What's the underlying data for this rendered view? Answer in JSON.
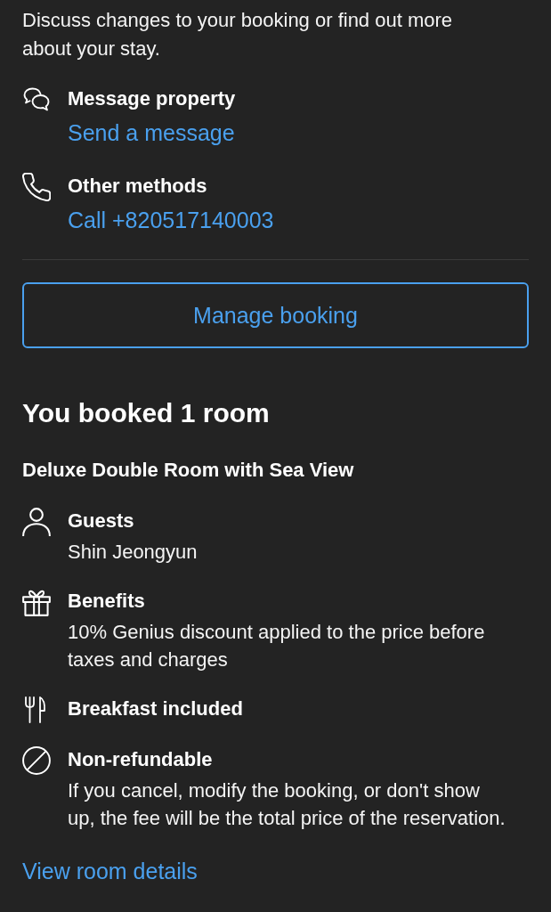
{
  "contact": {
    "intro": "Discuss changes to your booking or find out more about your stay.",
    "methods": [
      {
        "kind": "message",
        "title": "Message property",
        "link": "Send a message"
      },
      {
        "kind": "phone",
        "title": "Other methods",
        "link": "Call +820517140003"
      }
    ]
  },
  "manage_button": "Manage booking",
  "booking": {
    "heading": "You booked 1 room",
    "room_name": "Deluxe Double Room with Sea View",
    "details": [
      {
        "kind": "guests",
        "title": "Guests",
        "text": "Shin Jeongyun"
      },
      {
        "kind": "benefits",
        "title": "Benefits",
        "text": "10% Genius discount applied to the price before taxes and charges"
      },
      {
        "kind": "breakfast",
        "title": "Breakfast included"
      },
      {
        "kind": "non_refundable",
        "title": "Non-refundable",
        "text": "If you cancel, modify the booking, or don't show up, the fee will be the total price of the reservation."
      }
    ],
    "link": "View room details"
  }
}
